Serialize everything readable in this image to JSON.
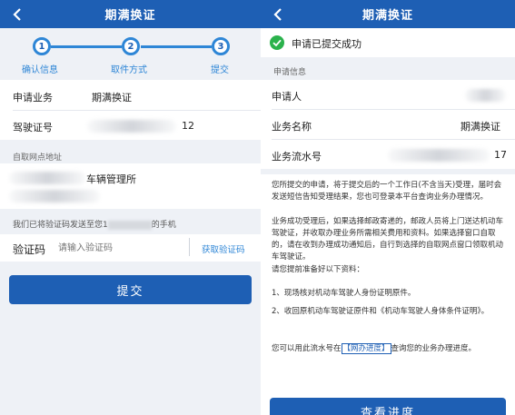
{
  "left": {
    "header_title": "期满换证",
    "steps": [
      {
        "num": "1",
        "label": "确认信息"
      },
      {
        "num": "2",
        "label": "取件方式"
      },
      {
        "num": "3",
        "label": "提交"
      }
    ],
    "business_label": "申请业务",
    "business_value": "期满换证",
    "license_label": "驾驶证号",
    "license_value": "12",
    "pickup_caption": "自取网点地址",
    "pickup_value": "车辆管理所",
    "sms_note_prefix": "我们已将验证码发送至您1",
    "sms_note_suffix": "的手机",
    "code_label": "验证码",
    "code_placeholder": "请输入验证码",
    "get_code_label": "获取验证码",
    "submit_label": "提交"
  },
  "right": {
    "header_title": "期满换证",
    "success_text": "申请已提交成功",
    "applicant_caption": "申请信息",
    "applicant_label": "申请人",
    "biz_name_label": "业务名称",
    "biz_name_value": "期满换证",
    "serial_label": "业务流水号",
    "serial_value": "17",
    "para1": "您所提交的申请，将于提交后的一个工作日(不含当天)受理，届时会发送短信告知受理结果，您也可登录本平台查询业务办理情况。",
    "para2": "业务成功受理后，如果选择邮政寄递的，邮政人员将上门送达机动车驾驶证，并收取办理业务所需相关费用和资料。如果选择窗口自取的，请在收到办理成功通知后，自行到选择的自取网点窗口领取机动车驾驶证。",
    "para3": "请您提前准备好以下资料：",
    "item1": "1、现场核对机动车驾驶人身份证明原件。",
    "item2": "2、收回原机动车驾驶证原件和《机动车驾驶人身体条件证明》。",
    "query_prefix": "您可以用此流水号在",
    "query_link": "【网办进度】",
    "query_suffix": "查询您的业务办理进度。",
    "view_progress_label": "查看进度"
  }
}
